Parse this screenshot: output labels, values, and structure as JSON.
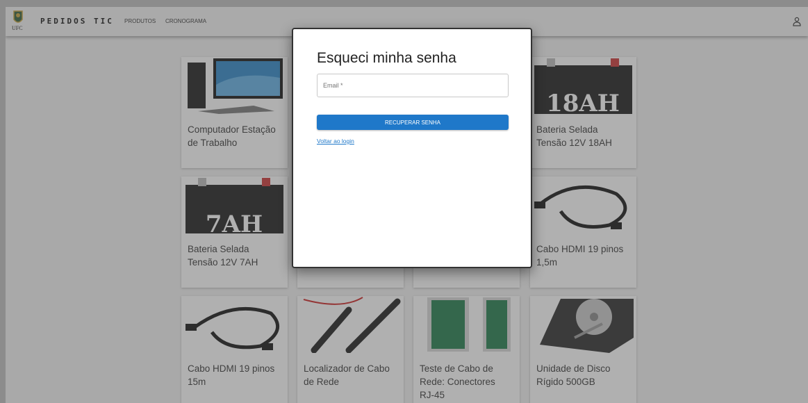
{
  "header": {
    "logo_text": "UFC",
    "brand": "PEDIDOS TIC",
    "nav": [
      "PRODUTOS",
      "CRONOGRAMA"
    ]
  },
  "products": [
    {
      "name": "Computador Estação de Trabalho",
      "image": "computer-image"
    },
    {
      "name": "",
      "image": ""
    },
    {
      "name": "",
      "image": ""
    },
    {
      "name": "Bateria Selada Tensão 12V 18AH",
      "image": "battery-18ah-image"
    },
    {
      "name": "Bateria Selada Tensão 12V 7AH",
      "image": "battery-7ah-image"
    },
    {
      "name": "",
      "image": ""
    },
    {
      "name": "",
      "image": ""
    },
    {
      "name": "Cabo HDMI 19 pinos 1,5m",
      "image": "hdmi-cable-image"
    },
    {
      "name": "Cabo HDMI 19 pinos 15m",
      "image": "hdmi-cable-image"
    },
    {
      "name": "Localizador de Cabo de Rede",
      "image": "cable-locator-image"
    },
    {
      "name": "Teste de Cabo de Rede: Conectores RJ-45",
      "image": "cable-tester-image"
    },
    {
      "name": "Unidade de Disco Rígido 500GB",
      "image": "hard-disk-image"
    }
  ],
  "battery_labels": {
    "big": "18AH",
    "small": "7AH"
  },
  "modal": {
    "title": "Esqueci minha senha",
    "email_placeholder": "Email *",
    "email_value": "",
    "submit_label": "RECUPERAR SENHA",
    "back_link": "Voltar ao login"
  },
  "colors": {
    "primary": "#1f78c9",
    "overlay": "rgba(80,80,80,0.45)"
  }
}
